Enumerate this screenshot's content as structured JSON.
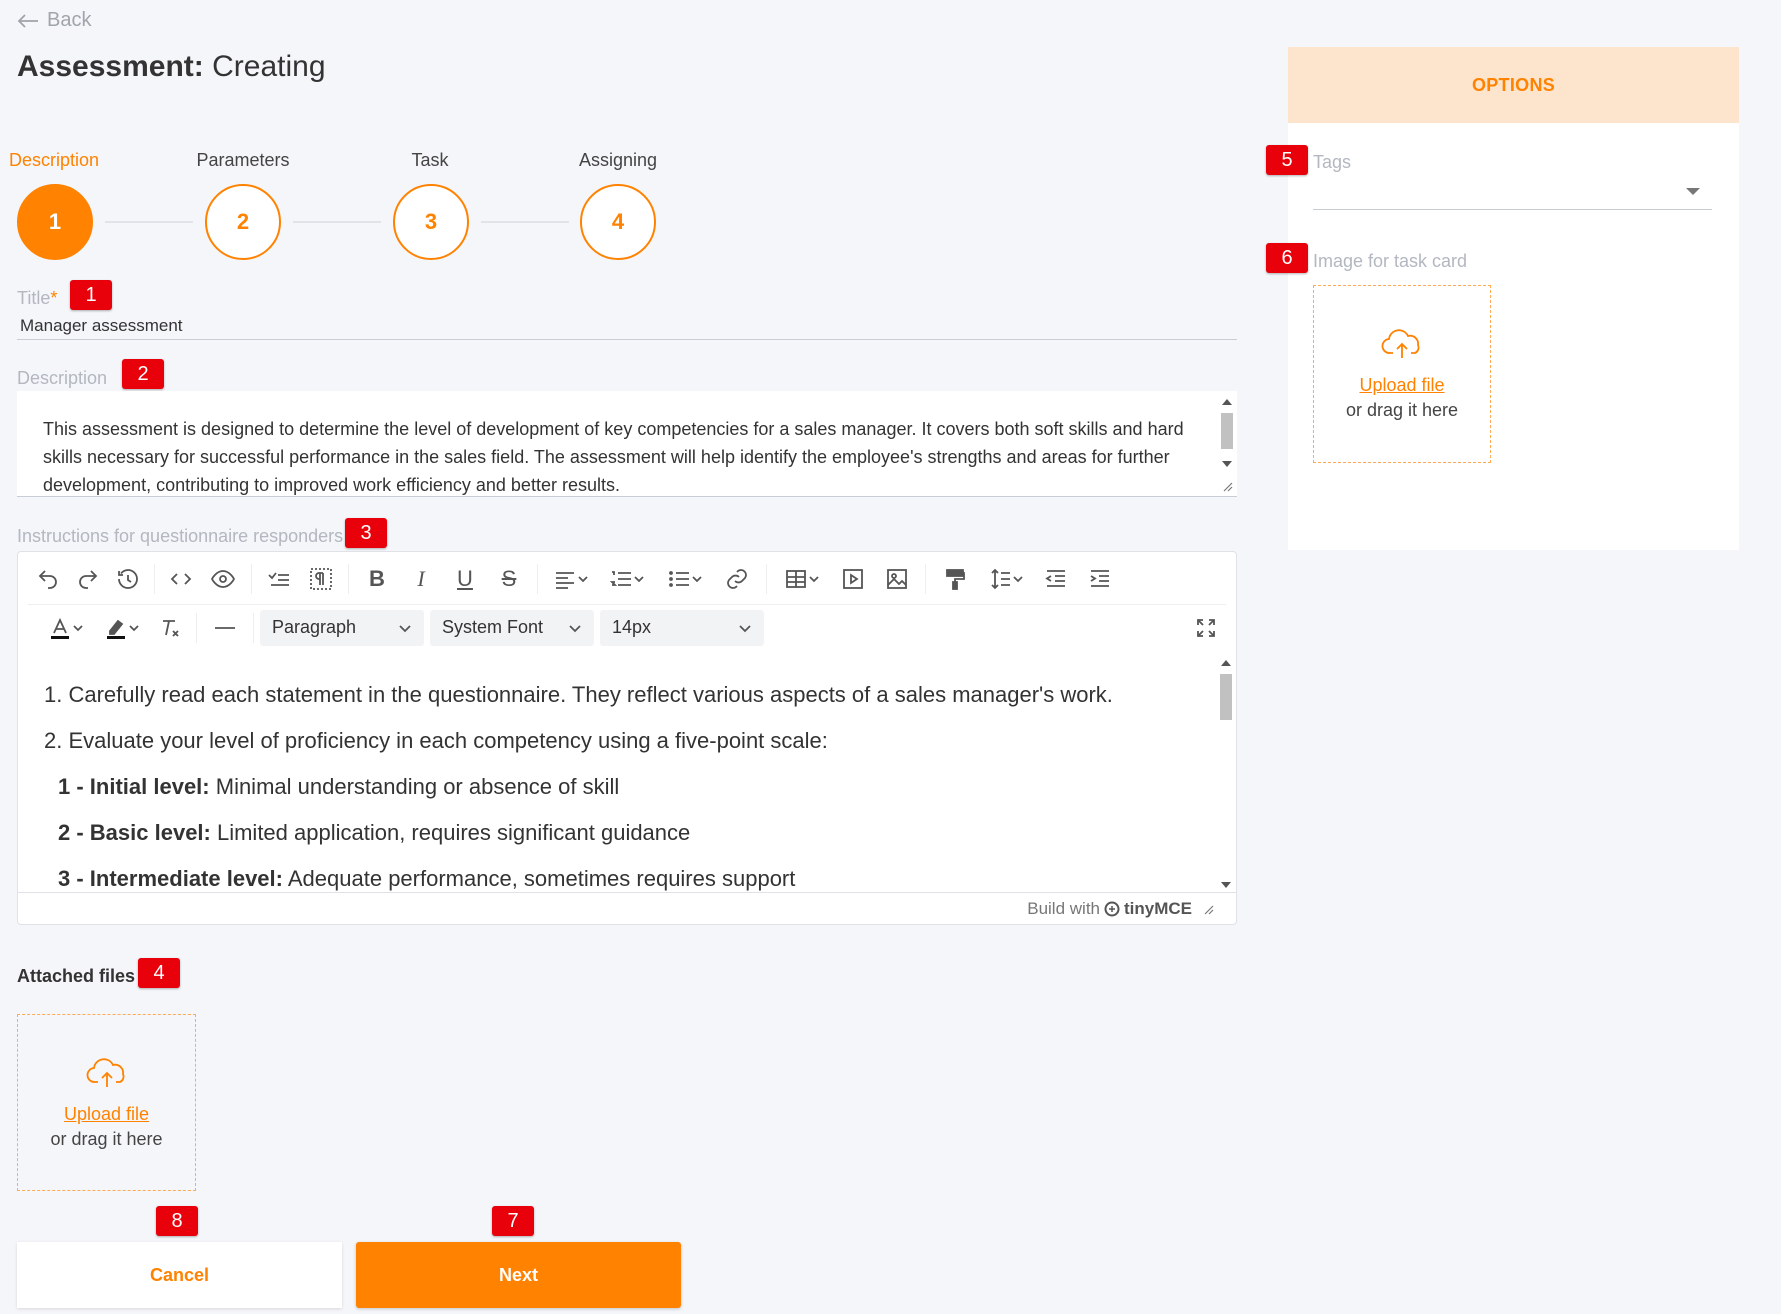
{
  "nav": {
    "back_label": "Back"
  },
  "page": {
    "title_bold": "Assessment:",
    "title_sub": "Creating"
  },
  "stepper": {
    "steps": [
      {
        "label": "Description",
        "number": "1"
      },
      {
        "label": "Parameters",
        "number": "2"
      },
      {
        "label": "Task",
        "number": "3"
      },
      {
        "label": "Assigning",
        "number": "4"
      }
    ]
  },
  "form": {
    "title_label": "Title",
    "title_required_mark": "*",
    "title_value": "Manager assessment",
    "description_label": "Description",
    "description_value": "This assessment is designed to determine the level of development of key competencies for a sales manager. It covers both soft skills and hard skills necessary for successful performance in the sales field. The assessment will help identify the employee's strengths and areas for further development, contributing to improved work efficiency and better results.",
    "instructions_label": "Instructions for questionnaire responders",
    "attached_files_label": "Attached files"
  },
  "editor": {
    "block_format": "Paragraph",
    "font_family": "System Font",
    "font_size": "14px",
    "content": {
      "line1": "1. Carefully read each statement in the questionnaire. They reflect various aspects of a sales manager's work.",
      "line2": "2. Evaluate your level of proficiency in each competency using a five-point scale:",
      "levels": [
        {
          "num": "1 - ",
          "name": "Initial level:",
          "desc": " Minimal understanding or absence of skill"
        },
        {
          "num": "2 - ",
          "name": "Basic level:",
          "desc": " Limited application, requires significant guidance"
        },
        {
          "num": "3 - ",
          "name": "Intermediate level:",
          "desc": " Adequate performance, sometimes requires support"
        }
      ]
    },
    "status_prefix": "Build with",
    "status_brand": "tinyMCE"
  },
  "upload": {
    "link": "Upload file",
    "hint": "or drag it here"
  },
  "buttons": {
    "cancel": "Cancel",
    "next": "Next"
  },
  "options": {
    "header": "OPTIONS",
    "tags_label": "Tags",
    "image_label": "Image for task card"
  },
  "badges": [
    "1",
    "2",
    "3",
    "4",
    "5",
    "6",
    "7",
    "8"
  ],
  "colors": {
    "accent": "#ff8200",
    "options_header_bg": "#fde4cc",
    "badge": "#e8000a"
  }
}
